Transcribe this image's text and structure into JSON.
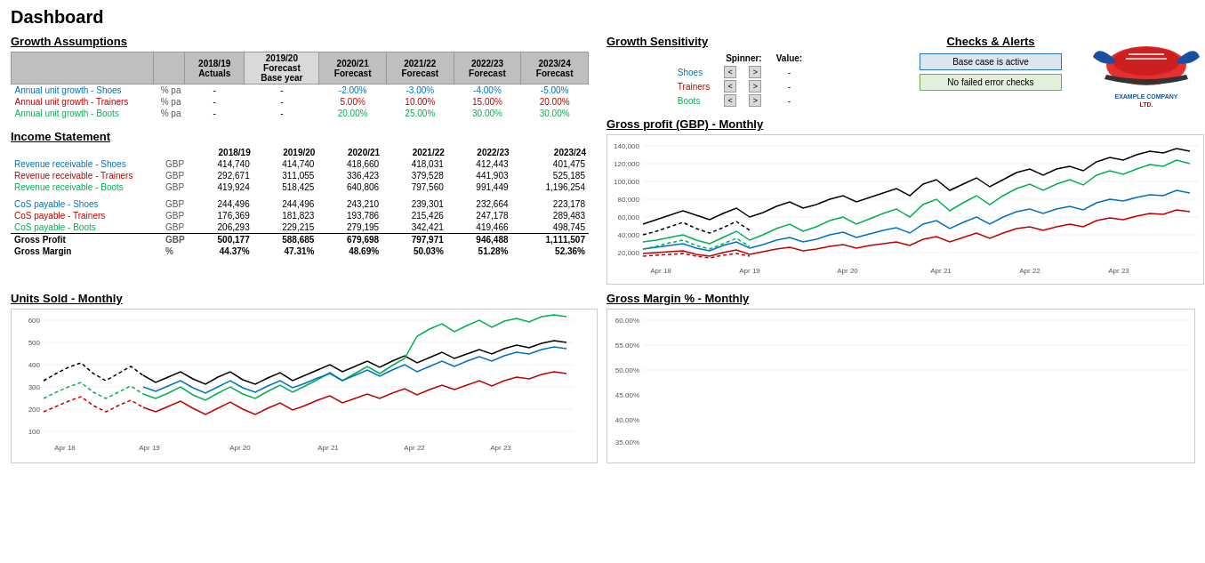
{
  "title": "Dashboard",
  "growth_assumptions": {
    "title": "Growth Assumptions",
    "headers": [
      "",
      "",
      "2018/19\nActuals",
      "2019/20\nForecast\nBase year",
      "2020/21\nForecast",
      "2021/22\nForecast",
      "2022/23\nForecast",
      "2023/24\nForecast"
    ],
    "rows": [
      {
        "label": "Annual unit growth - Shoes",
        "unit": "% pa",
        "color": "blue",
        "values": [
          "-",
          "-",
          "-2.00%",
          "-3.00%",
          "-4.00%",
          "-5.00%"
        ]
      },
      {
        "label": "Annual unit growth - Trainers",
        "unit": "% pa",
        "color": "red",
        "values": [
          "-",
          "-",
          "5.00%",
          "10.00%",
          "15.00%",
          "20.00%"
        ]
      },
      {
        "label": "Annual unit growth - Boots",
        "unit": "% pa",
        "color": "green",
        "values": [
          "-",
          "-",
          "20.00%",
          "25.00%",
          "30.00%",
          "30.00%"
        ]
      }
    ]
  },
  "income_statement": {
    "title": "Income Statement",
    "years": [
      "2018/19",
      "2019/20",
      "2020/21",
      "2021/22",
      "2022/23",
      "2023/24"
    ],
    "revenue": [
      {
        "label": "Revenue receivable - Shoes",
        "curr": "GBP",
        "color": "blue",
        "values": [
          "414,740",
          "414,740",
          "418,660",
          "418,031",
          "412,443",
          "401,475"
        ]
      },
      {
        "label": "Revenue receivable - Trainers",
        "curr": "GBP",
        "color": "red",
        "values": [
          "292,671",
          "311,055",
          "336,423",
          "379,528",
          "441,903",
          "525,185"
        ]
      },
      {
        "label": "Revenue receivable - Boots",
        "curr": "GBP",
        "color": "green",
        "values": [
          "419,924",
          "518,425",
          "640,806",
          "797,560",
          "991,449",
          "1,196,254"
        ]
      }
    ],
    "cos": [
      {
        "label": "CoS payable - Shoes",
        "curr": "GBP",
        "color": "blue",
        "values": [
          "244,496",
          "244,496",
          "243,210",
          "239,301",
          "232,664",
          "223,178"
        ]
      },
      {
        "label": "CoS payable - Trainers",
        "curr": "GBP",
        "color": "red",
        "values": [
          "176,369",
          "181,823",
          "193,786",
          "215,426",
          "247,178",
          "289,483"
        ]
      },
      {
        "label": "CoS payable - Boots",
        "curr": "GBP",
        "color": "green",
        "values": [
          "206,293",
          "229,215",
          "279,195",
          "342,421",
          "419,466",
          "498,745"
        ]
      }
    ],
    "gross_profit": {
      "label": "Gross Profit",
      "curr": "GBP",
      "values": [
        "500,177",
        "588,685",
        "679,698",
        "797,971",
        "946,488",
        "1,111,507"
      ]
    },
    "gross_margin": {
      "label": "Gross Margin",
      "curr": "%",
      "values": [
        "44.37%",
        "47.31%",
        "48.69%",
        "50.03%",
        "51.28%",
        "52.36%"
      ]
    }
  },
  "growth_sensitivity": {
    "title": "Growth Sensitivity",
    "spinner_header_spinner": "Spinner:",
    "spinner_header_value": "Value:",
    "rows": [
      {
        "label": "Shoes",
        "color": "blue",
        "value": "-"
      },
      {
        "label": "Trainers",
        "color": "red",
        "value": "-"
      },
      {
        "label": "Boots",
        "color": "green",
        "value": "-"
      }
    ]
  },
  "checks_alerts": {
    "title": "Checks & Alerts",
    "base_case": "Base case is active",
    "no_errors": "No failed error checks"
  },
  "charts": {
    "gross_profit_title": "Gross profit (GBP) - Monthly",
    "units_sold_title": "Units Sold - Monthly",
    "gross_margin_title": "Gross Margin % - Monthly"
  }
}
